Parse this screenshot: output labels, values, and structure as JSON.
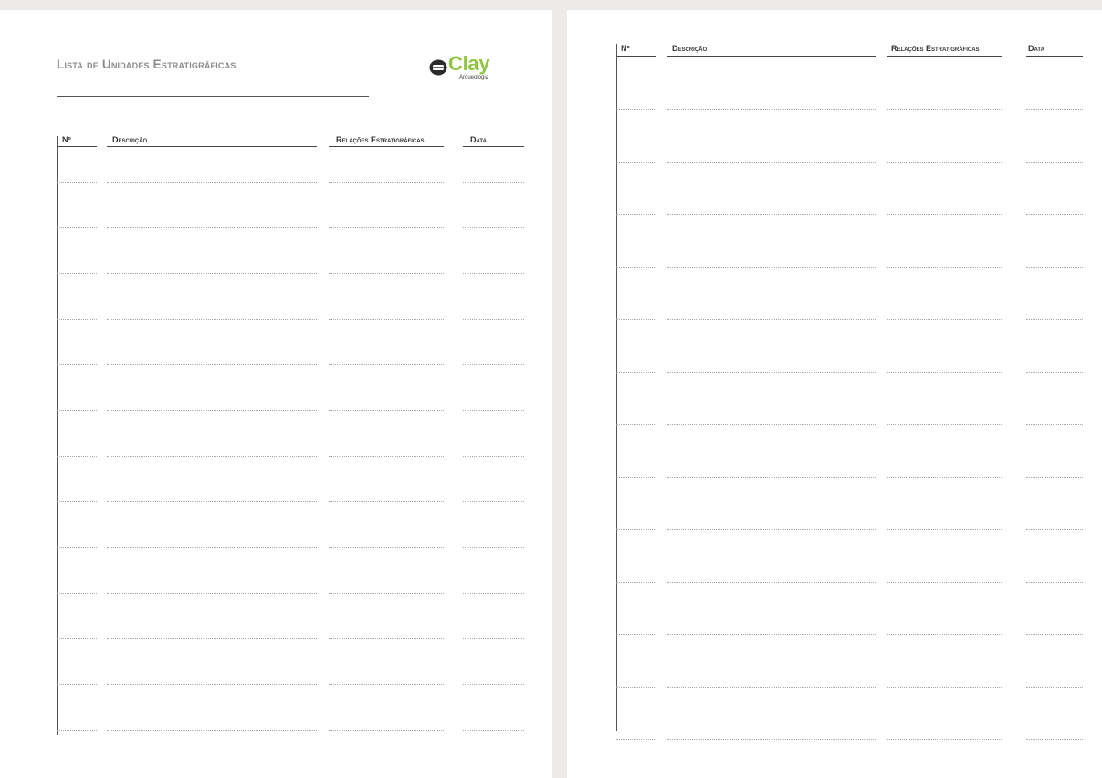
{
  "document": {
    "title": "Lista de Unidades Estratigráficas",
    "logo": {
      "name": "Clay",
      "subtitle": "Arqueologia",
      "icon": "clay-logo-icon",
      "brand_color": "#8fc640",
      "icon_color": "#2b2b2b"
    },
    "columns": {
      "number": "Nº",
      "description": "Descrição",
      "relations": "Relações Estratigráficas",
      "date": "Data"
    },
    "pages": [
      {
        "name": "left",
        "rows": 13
      },
      {
        "name": "right",
        "rows": 13
      }
    ]
  }
}
